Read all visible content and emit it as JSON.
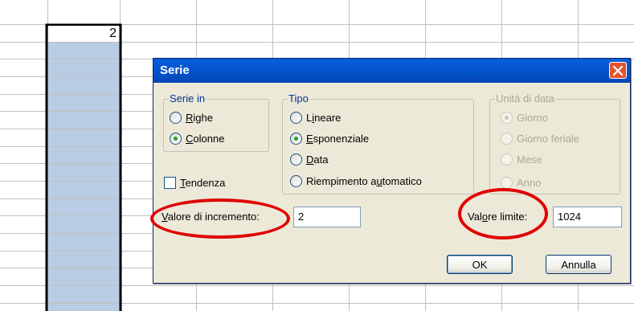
{
  "sheet": {
    "active_cell_value": "2"
  },
  "dialog": {
    "title": "Serie",
    "series_in": {
      "label": "Serie in",
      "options": [
        {
          "label": "Righe",
          "accel": "R",
          "checked": false
        },
        {
          "label": "Colonne",
          "accel": "C",
          "checked": true
        }
      ]
    },
    "type": {
      "label": "Tipo",
      "options": [
        {
          "label": "Lineare",
          "accel": "i",
          "checked": false
        },
        {
          "label": "Esponenziale",
          "accel": "E",
          "checked": true
        },
        {
          "label": "Data",
          "accel": "D",
          "checked": false
        },
        {
          "label": "Riempimento automatico",
          "accel": "u",
          "checked": false
        }
      ]
    },
    "date_unit": {
      "label": "Unità di data",
      "options": [
        {
          "label": "Giorno",
          "checked": true
        },
        {
          "label": "Giorno feriale",
          "checked": false
        },
        {
          "label": "Mese",
          "checked": false
        },
        {
          "label": "Anno",
          "checked": false
        }
      ]
    },
    "trend": {
      "label": "Tendenza",
      "checked": false
    },
    "step_value": {
      "label": "Valore di incremento:",
      "value": "2"
    },
    "stop_value": {
      "label": "Valore limite:",
      "value": "1024"
    },
    "buttons": {
      "ok": "OK",
      "cancel": "Annulla"
    }
  },
  "colors": {
    "highlight_column": "#b8cce4",
    "annotation_ellipse": "#e00000",
    "title_bar": "#0556d0"
  }
}
